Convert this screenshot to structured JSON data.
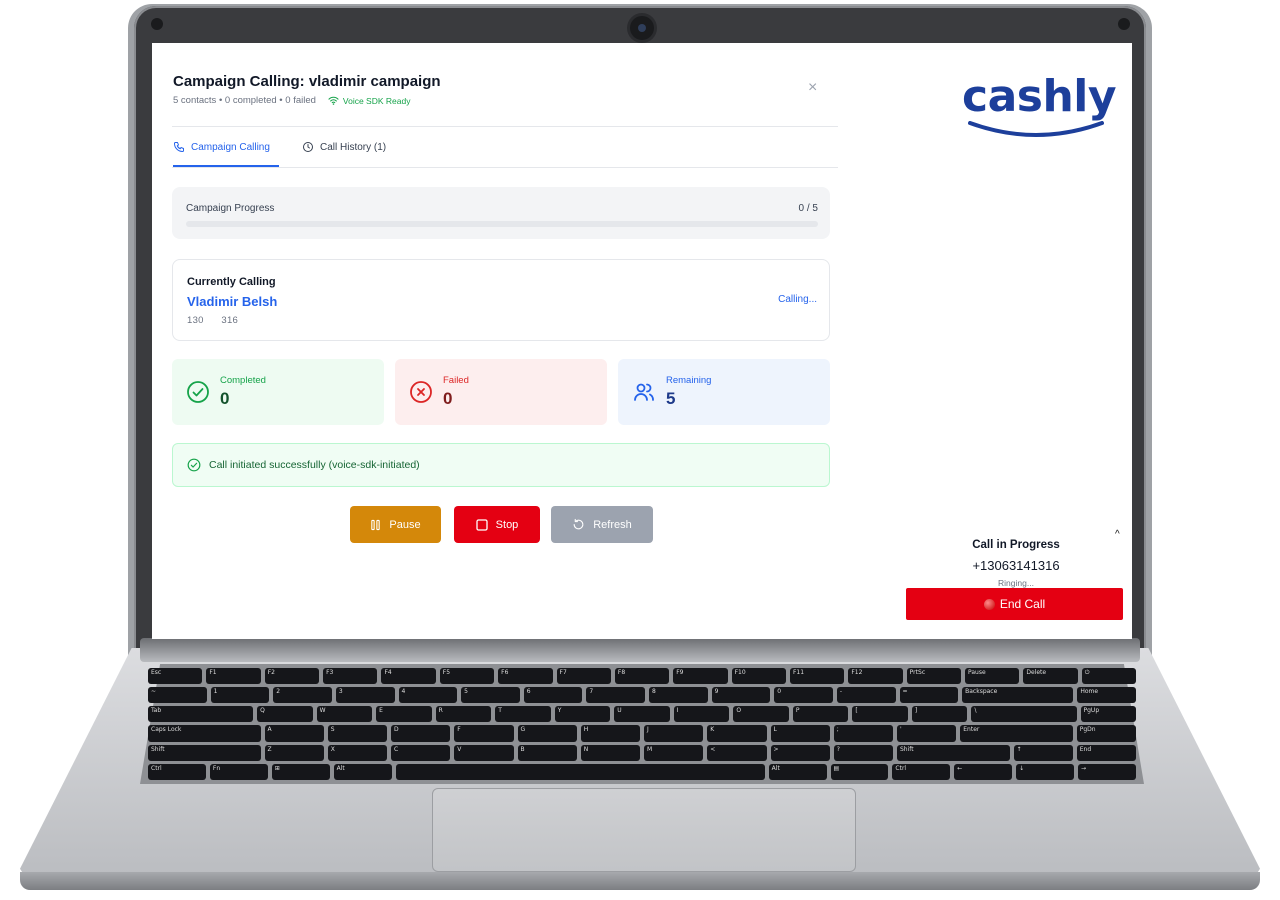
{
  "modal": {
    "title": "Campaign Calling: vladimir campaign",
    "subtitle_counts": "5 contacts • 0 completed • 0 failed",
    "sdk_status": "Voice SDK Ready",
    "close_glyph": "×"
  },
  "tabs": [
    {
      "label": "Campaign Calling",
      "icon": "phone-icon",
      "active": true
    },
    {
      "label": "Call History (1)",
      "icon": "clock-icon",
      "active": false
    }
  ],
  "progress": {
    "label": "Campaign Progress",
    "count": "0 / 5",
    "fraction": 0
  },
  "current_call": {
    "heading": "Currently Calling",
    "name": "Vladimir Belsh",
    "number": "130      316",
    "status": "Calling..."
  },
  "stats": [
    {
      "label": "Completed",
      "value": "0",
      "icon": "check-circle-icon",
      "bg": "#eefbf2",
      "color": "#16a34a"
    },
    {
      "label": "Failed",
      "value": "0",
      "icon": "x-circle-icon",
      "bg": "#fdeeee",
      "color": "#dc2626"
    },
    {
      "label": "Remaining",
      "value": "5",
      "icon": "users-icon",
      "bg": "#eef4fd",
      "color": "#2563eb"
    }
  ],
  "alert": {
    "text": "Call initiated successfully (voice-sdk-initiated)",
    "icon": "check-circle-icon"
  },
  "buttons": {
    "pause": {
      "label": "Pause",
      "icon": "pause-icon",
      "color": "#d4880a"
    },
    "stop": {
      "label": "Stop",
      "icon": "square-icon",
      "color": "#e40012"
    },
    "refresh": {
      "label": "Refresh",
      "icon": "refresh-icon",
      "color": "#9ca3af"
    }
  },
  "brand": {
    "name": "cashly",
    "color": "#1d3f9b"
  },
  "call_in_progress": {
    "title": "Call in Progress",
    "number": "+13063141316",
    "status": "Ringing...",
    "end_label": "End Call",
    "collapse_glyph": "^"
  }
}
